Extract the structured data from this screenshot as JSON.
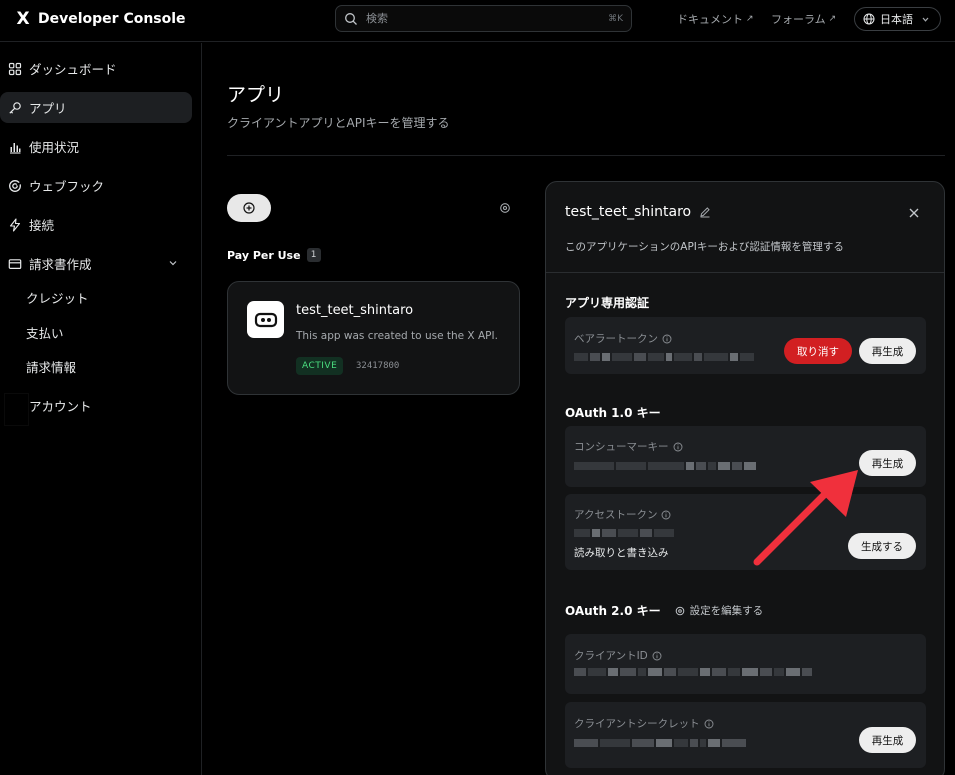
{
  "header": {
    "logo": "X",
    "brand": "Developer Console",
    "search_placeholder": "検索",
    "shortcut": "⌘K",
    "docs_link": "ドキュメント",
    "forum_link": "フォーラム",
    "external_glyph": "↗",
    "language": "日本語"
  },
  "sidebar": {
    "items": [
      {
        "label": "ダッシュボード",
        "icon": "grid-icon"
      },
      {
        "label": "アプリ",
        "icon": "key-icon"
      },
      {
        "label": "使用状況",
        "icon": "bar-chart-icon"
      },
      {
        "label": "ウェブフック",
        "icon": "webhook-icon"
      },
      {
        "label": "接続",
        "icon": "bolt-icon"
      },
      {
        "label": "請求書作成",
        "icon": "card-icon"
      }
    ],
    "billing_sub": [
      "クレジット",
      "支払い",
      "請求情報"
    ],
    "account": "アカウント"
  },
  "main": {
    "title": "アプリ",
    "subtitle": "クライアントアプリとAPIキーを管理する",
    "section": "Pay Per Use",
    "section_count": "1",
    "app": {
      "name": "test_teet_shintaro",
      "description": "This app was created to use the X API.",
      "status": "ACTIVE",
      "id": "32417800"
    }
  },
  "panel": {
    "title": "test_teet_shintaro",
    "subtitle": "このアプリケーションのAPIキーおよび認証情報を管理する",
    "app_auth": {
      "heading": "アプリ専用認証",
      "bearer_label": "ベアラートークン",
      "revoke": "取り消す",
      "regenerate": "再生成"
    },
    "oauth1": {
      "heading": "OAuth 1.0 キー",
      "consumer_label": "コンシューマーキー",
      "regenerate": "再生成",
      "access_label": "アクセストークン",
      "permission": "読み取りと書き込み",
      "generate": "生成する"
    },
    "oauth2": {
      "heading": "OAuth 2.0 キー",
      "edit_settings": "設定を編集する",
      "client_id_label": "クライアントID",
      "client_secret_label": "クライアントシークレット",
      "regenerate": "再生成"
    }
  },
  "colors": {
    "accent_red": "#d21f22",
    "annotation_arrow": "#f0303c",
    "active_green": "#4ade80"
  }
}
